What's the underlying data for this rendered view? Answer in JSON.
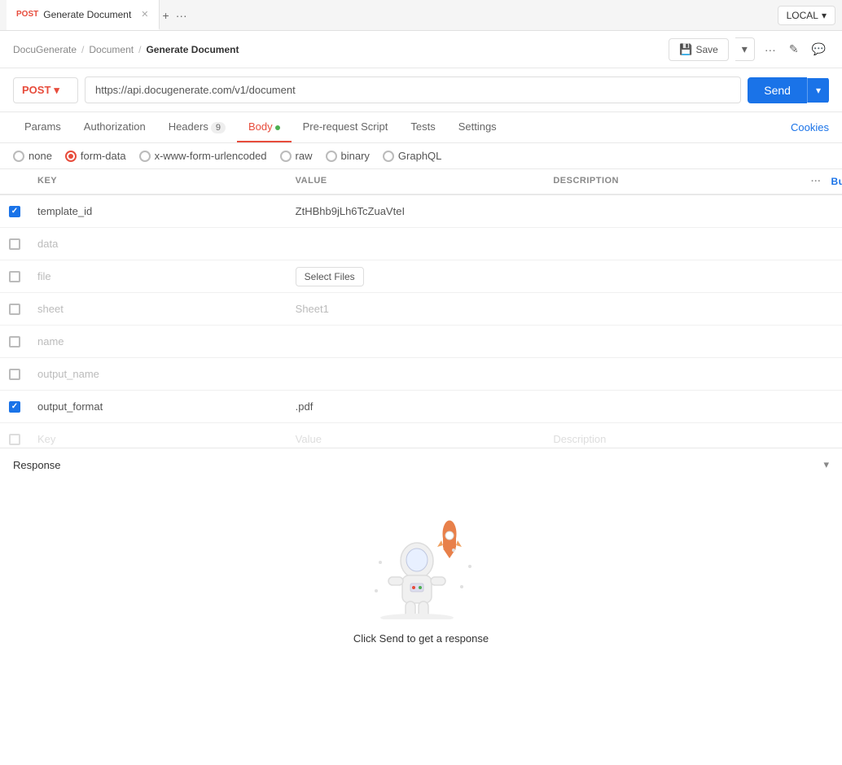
{
  "tabBar": {
    "activeTab": {
      "method": "POST",
      "label": "Generate Document"
    },
    "plusIcon": "+",
    "moreIcon": "···",
    "envSelector": {
      "label": "LOCAL",
      "chevron": "▾"
    }
  },
  "breadcrumb": {
    "items": [
      "DocuGenerate",
      "Document",
      "Generate Document"
    ],
    "separators": [
      "/",
      "/"
    ],
    "saveLabel": "Save",
    "moreIcon": "···",
    "editIcon": "✎",
    "commentIcon": "💬"
  },
  "urlBar": {
    "method": "POST",
    "methodChevron": "▾",
    "url": "https://api.docugenerate.com/v1/document",
    "sendLabel": "Send",
    "sendChevron": "▾"
  },
  "requestTabs": {
    "tabs": [
      {
        "id": "params",
        "label": "Params",
        "active": false
      },
      {
        "id": "authorization",
        "label": "Authorization",
        "active": false
      },
      {
        "id": "headers",
        "label": "Headers",
        "badge": "9",
        "active": false
      },
      {
        "id": "body",
        "label": "Body",
        "hasDot": true,
        "active": true
      },
      {
        "id": "prerequest",
        "label": "Pre-request Script",
        "active": false
      },
      {
        "id": "tests",
        "label": "Tests",
        "active": false
      },
      {
        "id": "settings",
        "label": "Settings",
        "active": false
      }
    ],
    "cookiesLink": "Cookies"
  },
  "bodyTypes": [
    {
      "id": "none",
      "label": "none",
      "checked": false
    },
    {
      "id": "form-data",
      "label": "form-data",
      "checked": true
    },
    {
      "id": "urlencoded",
      "label": "x-www-form-urlencoded",
      "checked": false
    },
    {
      "id": "raw",
      "label": "raw",
      "checked": false
    },
    {
      "id": "binary",
      "label": "binary",
      "checked": false
    },
    {
      "id": "graphql",
      "label": "GraphQL",
      "checked": false
    }
  ],
  "table": {
    "columns": [
      "KEY",
      "VALUE",
      "DESCRIPTION"
    ],
    "bulkEditLabel": "Bulk Edit",
    "moreIcon": "···",
    "rows": [
      {
        "checked": true,
        "key": "template_id",
        "value": "ZtHBhb9jLh6TcZuaVteI",
        "description": "",
        "type": "text"
      },
      {
        "checked": false,
        "key": "data",
        "value": "",
        "description": "",
        "type": "text"
      },
      {
        "checked": false,
        "key": "file",
        "value": "",
        "description": "",
        "type": "file",
        "fileBtn": "Select Files"
      },
      {
        "checked": false,
        "key": "sheet",
        "value": "",
        "description": "",
        "type": "text",
        "placeholder": "Sheet1"
      },
      {
        "checked": false,
        "key": "name",
        "value": "",
        "description": "",
        "type": "text"
      },
      {
        "checked": false,
        "key": "output_name",
        "value": "",
        "description": "",
        "type": "text"
      },
      {
        "checked": true,
        "key": "output_format",
        "value": ".pdf",
        "description": "",
        "type": "text"
      }
    ],
    "newRow": {
      "keyPlaceholder": "Key",
      "valuePlaceholder": "Value",
      "descriptionPlaceholder": "Description"
    }
  },
  "response": {
    "title": "Response",
    "chevronIcon": "▾",
    "emptyText": "Click Send to get a response"
  },
  "colors": {
    "postMethod": "#e74c3c",
    "activeTab": "#e74c3c",
    "sendBtn": "#1a73e8",
    "dotGreen": "#4caf50"
  }
}
